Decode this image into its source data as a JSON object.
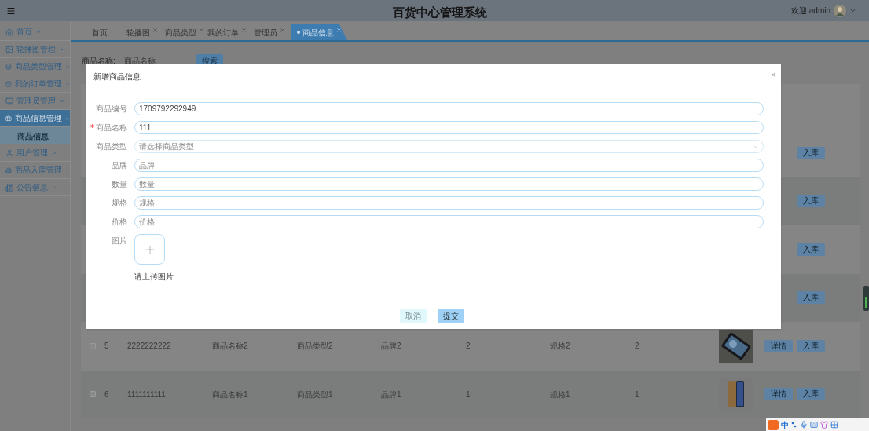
{
  "header": {
    "title": "百货中心管理系统",
    "welcome": "欢迎 admin"
  },
  "sidebar": {
    "items": [
      {
        "label": "首页",
        "expanded": false,
        "selected": false
      },
      {
        "label": "轮播图管理",
        "expanded": false,
        "selected": false
      },
      {
        "label": "商品类型管理",
        "expanded": false,
        "selected": false
      },
      {
        "label": "我的订单管理",
        "expanded": false,
        "selected": false
      },
      {
        "label": "管理员管理",
        "expanded": false,
        "selected": false
      },
      {
        "label": "商品信息管理",
        "expanded": true,
        "selected": true,
        "children": [
          {
            "label": "商品信息",
            "selected": true
          }
        ]
      },
      {
        "label": "用户管理",
        "expanded": false,
        "selected": false
      },
      {
        "label": "商品入库管理",
        "expanded": false,
        "selected": false
      },
      {
        "label": "公告信息",
        "expanded": false,
        "selected": false
      }
    ]
  },
  "tabs": [
    {
      "label": "首页",
      "closable": false,
      "selected": false
    },
    {
      "label": "轮播图",
      "closable": true,
      "selected": false
    },
    {
      "label": "商品类型",
      "closable": true,
      "selected": false
    },
    {
      "label": "我的订单",
      "closable": true,
      "selected": false
    },
    {
      "label": "管理员",
      "closable": true,
      "selected": false
    },
    {
      "label": "商品信息",
      "closable": true,
      "selected": true
    }
  ],
  "search": {
    "label": "商品名称:",
    "placeholder": "商品名称",
    "button": "搜索"
  },
  "table": {
    "rows": [
      {
        "kind": "covered",
        "actions": [
          "入库"
        ]
      },
      {
        "kind": "covered",
        "actions": [
          "入库"
        ]
      },
      {
        "kind": "covered",
        "actions": [
          "入库"
        ]
      },
      {
        "kind": "covered",
        "actions": [
          "入库"
        ]
      },
      {
        "kind": "full",
        "checked": false,
        "index": "5",
        "code": "2222222222",
        "name": "商品名称2",
        "type": "商品类型2",
        "brand": "品牌2",
        "quantity": "2",
        "spec": "规格2",
        "price": "2",
        "actions": [
          "详情",
          "入库"
        ]
      },
      {
        "kind": "full",
        "checked": false,
        "index": "6",
        "code": "1111111111",
        "name": "商品名称1",
        "type": "商品类型1",
        "brand": "品牌1",
        "quantity": "1",
        "spec": "规格1",
        "price": "1",
        "actions": [
          "详情",
          "入库"
        ]
      }
    ]
  },
  "dialog": {
    "title": "新增商品信息",
    "close": "×",
    "fields": [
      {
        "label": "商品编号",
        "kind": "input",
        "required": false,
        "value": "1709792292949"
      },
      {
        "label": "商品名称",
        "kind": "input",
        "required": true,
        "value": "111"
      },
      {
        "label": "商品类型",
        "kind": "select",
        "required": false,
        "placeholder": "请选择商品类型"
      },
      {
        "label": "品牌",
        "kind": "input",
        "required": false,
        "placeholder": "品牌"
      },
      {
        "label": "数量",
        "kind": "input",
        "required": false,
        "placeholder": "数量"
      },
      {
        "label": "规格",
        "kind": "input",
        "required": false,
        "placeholder": "规格"
      },
      {
        "label": "价格",
        "kind": "input",
        "required": false,
        "placeholder": "价格"
      },
      {
        "label": "图片",
        "kind": "upload",
        "required": false,
        "hint": "请上传图片"
      }
    ],
    "buttons": [
      {
        "label": "取消",
        "kind": "plain"
      },
      {
        "label": "提交",
        "kind": "primary"
      }
    ]
  },
  "ime": {
    "mode": "中"
  }
}
